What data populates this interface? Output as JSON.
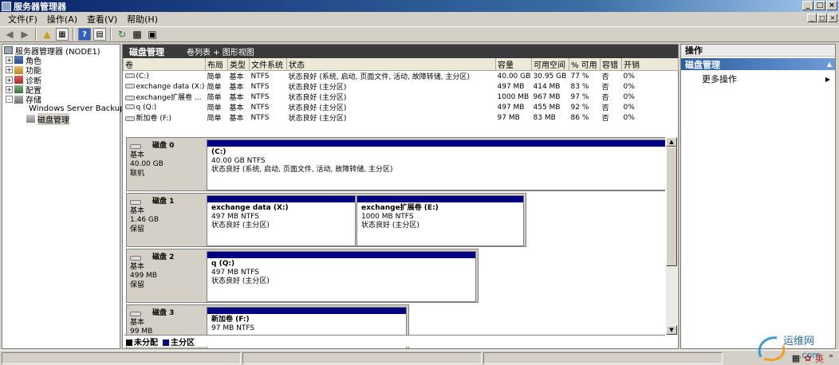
{
  "window": {
    "title": "服务器管理器",
    "buttons": [
      "_",
      "□",
      "×"
    ],
    "mdi_buttons": [
      "_",
      "□",
      "×"
    ]
  },
  "menu": [
    "文件(F)",
    "操作(A)",
    "查看(V)",
    "帮助(H)"
  ],
  "toolbar_icons": [
    "back-arrow-icon",
    "forward-arrow-icon",
    "up-folder-icon",
    "show-hide-tree-icon",
    "help-icon",
    "properties-icon",
    "refresh-icon",
    "export-list-icon",
    "console-icon"
  ],
  "tree": [
    {
      "label": "服务器管理器 (NODE1)",
      "level": 0,
      "expander": "",
      "icon": "server-icon"
    },
    {
      "label": "角色",
      "level": 1,
      "expander": "+",
      "icon": "roles-icon"
    },
    {
      "label": "功能",
      "level": 1,
      "expander": "+",
      "icon": "features-icon"
    },
    {
      "label": "诊断",
      "level": 1,
      "expander": "+",
      "icon": "diagnostics-icon"
    },
    {
      "label": "配置",
      "level": 1,
      "expander": "+",
      "icon": "configuration-icon"
    },
    {
      "label": "存储",
      "level": 1,
      "expander": "-",
      "icon": "storage-icon"
    },
    {
      "label": "Windows Server Backup",
      "level": 2,
      "expander": "",
      "icon": "backup-icon"
    },
    {
      "label": "磁盘管理",
      "level": 2,
      "expander": "",
      "icon": "disk-management-icon",
      "selected": true
    }
  ],
  "pane": {
    "title": "磁盘管理",
    "subtitle": "卷列表 + 图形视图"
  },
  "volumes": {
    "columns": [
      "卷",
      "布局",
      "类型",
      "文件系统",
      "状态",
      "容量",
      "可用空间",
      "% 可用",
      "容错",
      "开销"
    ],
    "rows": [
      [
        "(C:)",
        "简单",
        "基本",
        "NTFS",
        "状态良好 (系统, 启动, 页面文件, 活动, 故障转储, 主分区)",
        "40.00 GB",
        "30.95 GB",
        "77 %",
        "否",
        "0%"
      ],
      [
        "exchange data (X:)",
        "简单",
        "基本",
        "NTFS",
        "状态良好 (主分区)",
        "497 MB",
        "414 MB",
        "83 %",
        "否",
        "0%"
      ],
      [
        "exchange扩展卷 ...",
        "简单",
        "基本",
        "NTFS",
        "状态良好 (主分区)",
        "1000 MB",
        "967 MB",
        "97 %",
        "否",
        "0%"
      ],
      [
        "q (Q:)",
        "简单",
        "基本",
        "NTFS",
        "状态良好 (主分区)",
        "497 MB",
        "455 MB",
        "92 %",
        "否",
        "0%"
      ],
      [
        "新加卷 (F:)",
        "简单",
        "基本",
        "NTFS",
        "状态良好 (主分区)",
        "97 MB",
        "83 MB",
        "86 %",
        "否",
        "0%"
      ]
    ]
  },
  "disks": [
    {
      "name": "磁盘 0",
      "type": "基本",
      "size": "40.00 GB",
      "status": "联机",
      "partitions": [
        {
          "name": "(C:)",
          "size": "40.00 GB NTFS",
          "status": "状态良好 (系统, 启动, 页面文件, 活动, 故障转储, 主分区)"
        }
      ]
    },
    {
      "name": "磁盘 1",
      "type": "基本",
      "size": "1.46 GB",
      "status": "保留",
      "partitions": [
        {
          "name": "exchange data  (X:)",
          "size": "497 MB NTFS",
          "status": "状态良好 (主分区)"
        },
        {
          "name": "exchange扩展卷  (E:)",
          "size": "1000 MB NTFS",
          "status": "状态良好 (主分区)"
        }
      ]
    },
    {
      "name": "磁盘 2",
      "type": "基本",
      "size": "499 MB",
      "status": "保留",
      "partitions": [
        {
          "name": "q  (Q:)",
          "size": "497 MB NTFS",
          "status": "状态良好 (主分区)"
        }
      ]
    },
    {
      "name": "磁盘 3",
      "type": "基本",
      "size": "99 MB",
      "status": "",
      "partitions": [
        {
          "name": "新加卷  (F:)",
          "size": "97 MB NTFS",
          "status": ""
        }
      ]
    }
  ],
  "legend": [
    {
      "label": "未分配",
      "color": "#000000"
    },
    {
      "label": "主分区",
      "color": "#000080"
    }
  ],
  "actions": {
    "header": "操作",
    "section": "磁盘管理",
    "items": [
      "更多操作"
    ]
  },
  "tray": {
    "ime": "英",
    "watermark_text": "运维网",
    "watermark_sub": ".com"
  }
}
